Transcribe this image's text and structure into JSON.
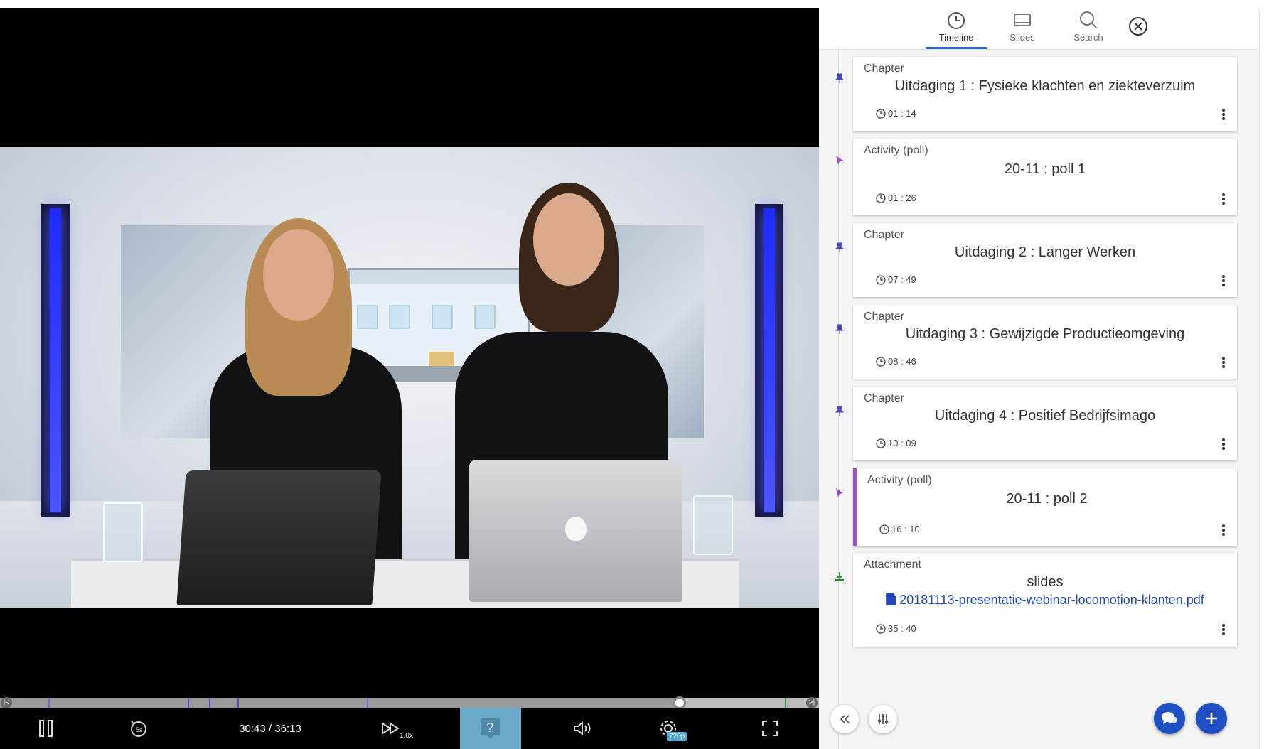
{
  "player": {
    "time_current": "30:43",
    "time_separator": " / ",
    "time_total": "36:13",
    "speed_label": "1.0x",
    "quality_label": "720p",
    "progress_fraction": 0.83,
    "buffered_fraction": 0.83
  },
  "tabs": [
    {
      "label": "Timeline",
      "icon": "clock-icon",
      "active": true
    },
    {
      "label": "Slides",
      "icon": "slides-icon",
      "active": false
    },
    {
      "label": "Search",
      "icon": "search-icon",
      "active": false
    }
  ],
  "timeline": [
    {
      "type": "Chapter",
      "title": "Uitdaging 1 : Fysieke klachten en ziekteverzuim",
      "time": "01 : 14",
      "pin": "pin-icon"
    },
    {
      "type": "Activity (poll)",
      "title": "20-11 : poll 1",
      "time": "01 : 26",
      "pin": "cursor-icon"
    },
    {
      "type": "Chapter",
      "title": "Uitdaging 2 : Langer Werken",
      "time": "07 : 49",
      "pin": "pin-icon"
    },
    {
      "type": "Chapter",
      "title": "Uitdaging 3 : Gewijzigde Productieomgeving",
      "time": "08 : 46",
      "pin": "pin-icon"
    },
    {
      "type": "Chapter",
      "title": "Uitdaging 4 : Positief Bedrijfsimago",
      "time": "10 : 09",
      "pin": "pin-icon"
    },
    {
      "type": "Activity (poll)",
      "title": "20-11 : poll 2",
      "time": "16 : 10",
      "pin": "cursor-icon",
      "highlighted": true
    },
    {
      "type": "Attachment",
      "title": "slides",
      "link": "20181113-presentatie-webinar-locomotion-klanten.pdf",
      "time": "35 : 40",
      "pin": "download-icon"
    }
  ],
  "colors": {
    "accent": "#2d62c9",
    "highlight": "#a14bc8",
    "link": "#2347b8",
    "fab": "#1f4fc1"
  }
}
